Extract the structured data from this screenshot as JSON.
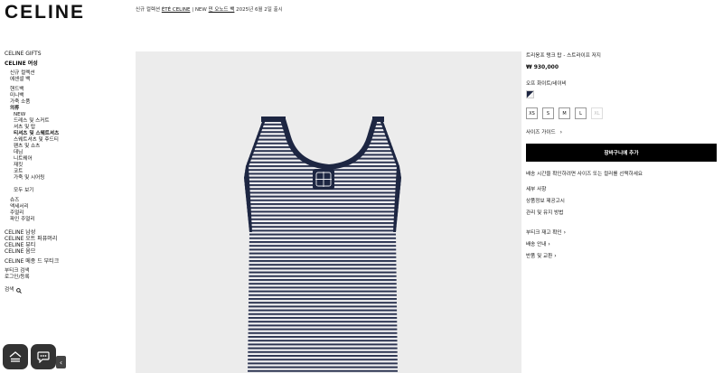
{
  "brand": {
    "logo": "CELINE"
  },
  "banner": {
    "prefix": "신규 컬렉션 ",
    "link1": "ÉTÉ CELINE",
    "mid": " | NEW ",
    "link2": "민 오노드 백",
    "suffix": " 2025년 6월 2일 출시"
  },
  "sidebar": {
    "gifts": "CELINE GIFTS",
    "women": "CELINE 여성",
    "women_sub": [
      "신규 컬렉션",
      "에센셜 백"
    ],
    "bags": [
      "핸드백",
      "미니백",
      "가죽 소품"
    ],
    "clothing": "의류",
    "clothing_items": [
      "NEW",
      "드레스 및 스커트",
      "셔츠 및 탑",
      "티셔츠 및 스웨트셔츠",
      "스웨트셔츠 및 후드티",
      "팬츠 및 쇼츠",
      "데님",
      "니트웨어",
      "재킷",
      "코트",
      "가죽 및 시어링"
    ],
    "view_all": "모두 보기",
    "others": [
      "슈즈",
      "액세서리",
      "주얼리",
      "파인 주얼리"
    ],
    "men": "CELINE 남성",
    "couture": "CELINE 오트 퍼퓨머리",
    "beauty": "CELINE 뷰티",
    "homme": "CELINE 옴므",
    "maison": "CELINE 메종 드 부티크",
    "boutique": "부티크 검색",
    "login": "로그인/등록",
    "search": "검색"
  },
  "product": {
    "name": "트리옹프 탱크 탑 - 스트라이프 저지",
    "price": "₩ 930,000",
    "color": "오프 화이트/네이비",
    "sizes": [
      "XS",
      "S",
      "M",
      "L",
      "XL"
    ],
    "unavailable_size": "XL",
    "size_guide": "사이즈 가이드",
    "add_to_cart": "장바구니에 추가",
    "delivery_note": "배송 시간을 확인하려면 사이즈 또는 컬러를 선택하세요",
    "info_links": [
      "세부 사항",
      "상품정보 제공고시",
      "관리 및 유지 방법"
    ],
    "action_links": [
      "부티크 재고 확인",
      "배송 안내",
      "반품 및 교환"
    ]
  },
  "colors": {
    "navy": "#1d2642",
    "stripe_light": "#f1f1f3",
    "bg": "#ececec"
  }
}
